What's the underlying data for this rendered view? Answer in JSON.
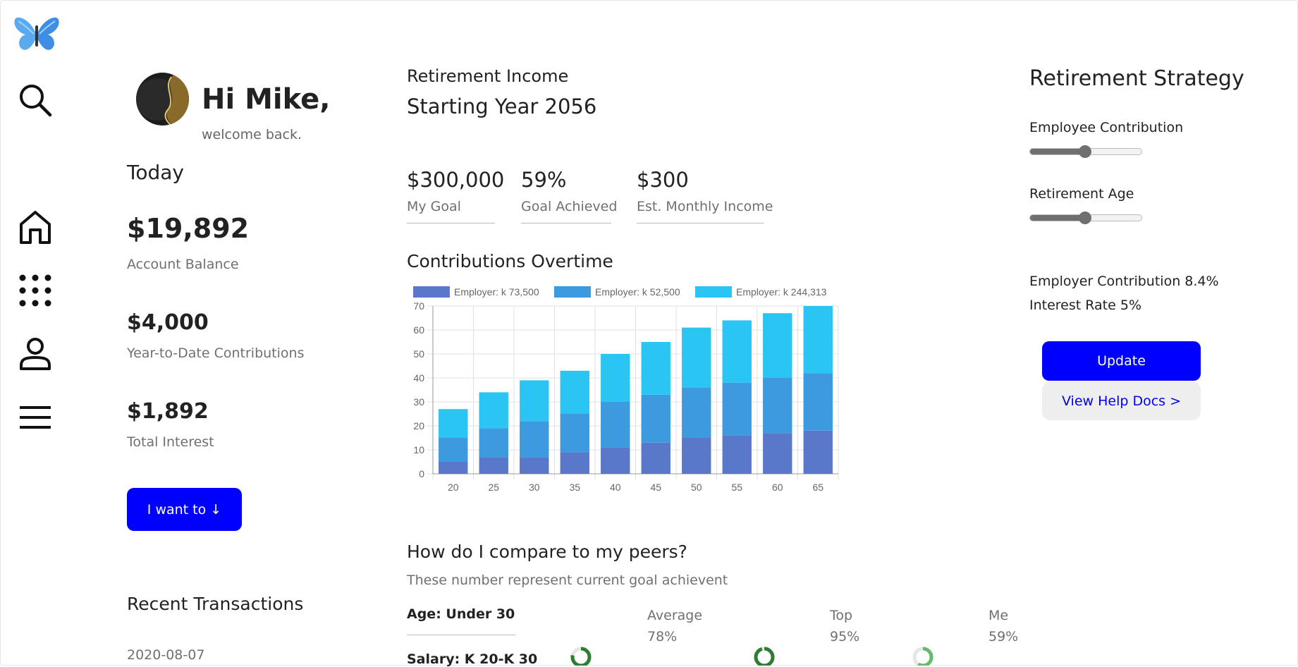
{
  "app": {
    "logo_icon": "butterfly-logo-icon",
    "accent_color": "#0000ff"
  },
  "nav": {
    "icons": [
      "search-icon",
      "home-icon",
      "apps-grid-icon",
      "user-icon",
      "menu-icon"
    ]
  },
  "profile": {
    "greeting": "Hi Mike,",
    "subtitle": "welcome back."
  },
  "today": {
    "title": "Today",
    "account_balance": {
      "value": "$19,892",
      "label": "Account Balance"
    },
    "ytd_contributions": {
      "value": "$4,000",
      "label": "Year-to-Date Contributions"
    },
    "total_interest": {
      "value": "$1,892",
      "label": "Total Interest"
    },
    "action_button": "I want to ↓"
  },
  "transactions": {
    "title": "Recent Transactions",
    "items": [
      {
        "date": "2020-08-07"
      }
    ]
  },
  "retirement_income": {
    "label": "Retirement Income",
    "starting_year": "Starting Year 2056",
    "stats": [
      {
        "value": "$300,000",
        "label": "My Goal"
      },
      {
        "value": "59%",
        "label": "Goal Achieved"
      },
      {
        "value": "$300",
        "label": "Est. Monthly Income"
      }
    ]
  },
  "contributions": {
    "title": "Contributions Overtime"
  },
  "chart_data": {
    "type": "bar",
    "stacked": true,
    "categories": [
      "20",
      "25",
      "30",
      "35",
      "40",
      "45",
      "50",
      "55",
      "60",
      "65"
    ],
    "series": [
      {
        "name": "Employer: k 73,500",
        "color": "#5a78c9",
        "values": [
          5,
          7,
          7,
          9,
          11,
          13,
          15,
          16,
          17,
          18
        ]
      },
      {
        "name": "Employer: k 52,500",
        "color": "#3d9ade",
        "values": [
          10,
          12,
          15,
          16,
          19,
          20,
          21,
          22,
          23,
          24
        ]
      },
      {
        "name": "Employer: k 244,313",
        "color": "#2ac5f2",
        "values": [
          12,
          15,
          17,
          18,
          20,
          22,
          25,
          26,
          27,
          28
        ]
      }
    ],
    "yticks": [
      "0",
      "10",
      "20",
      "30",
      "40",
      "50",
      "60",
      "70"
    ],
    "ylim": [
      0,
      70
    ],
    "grid": true,
    "legend_position": "top"
  },
  "peers": {
    "title": "How do I compare to my peers?",
    "subtitle": "These number represent current goal achievent",
    "filters": [
      "Age: Under 30",
      "Salary: K 20-K 30"
    ],
    "columns": [
      {
        "label": "Average",
        "value": "78%",
        "ring_color": "#2e7d32",
        "fraction": 0.78
      },
      {
        "label": "Top",
        "value": "95%",
        "ring_color": "#2e7d32",
        "fraction": 0.95
      },
      {
        "label": "Me",
        "value": "59%",
        "ring_color": "#66bb6a",
        "fraction": 0.59
      }
    ]
  },
  "strategy": {
    "title": "Retirement Strategy",
    "employee_contribution": {
      "label": "Employee Contribution",
      "fraction": 0.5
    },
    "retirement_age": {
      "label": "Retirement Age",
      "fraction": 0.5
    },
    "employer_contribution": "Employer Contribution 8.4%",
    "interest_rate": "Interest Rate 5%",
    "update_button": "Update",
    "help_button": "View Help Docs >"
  }
}
